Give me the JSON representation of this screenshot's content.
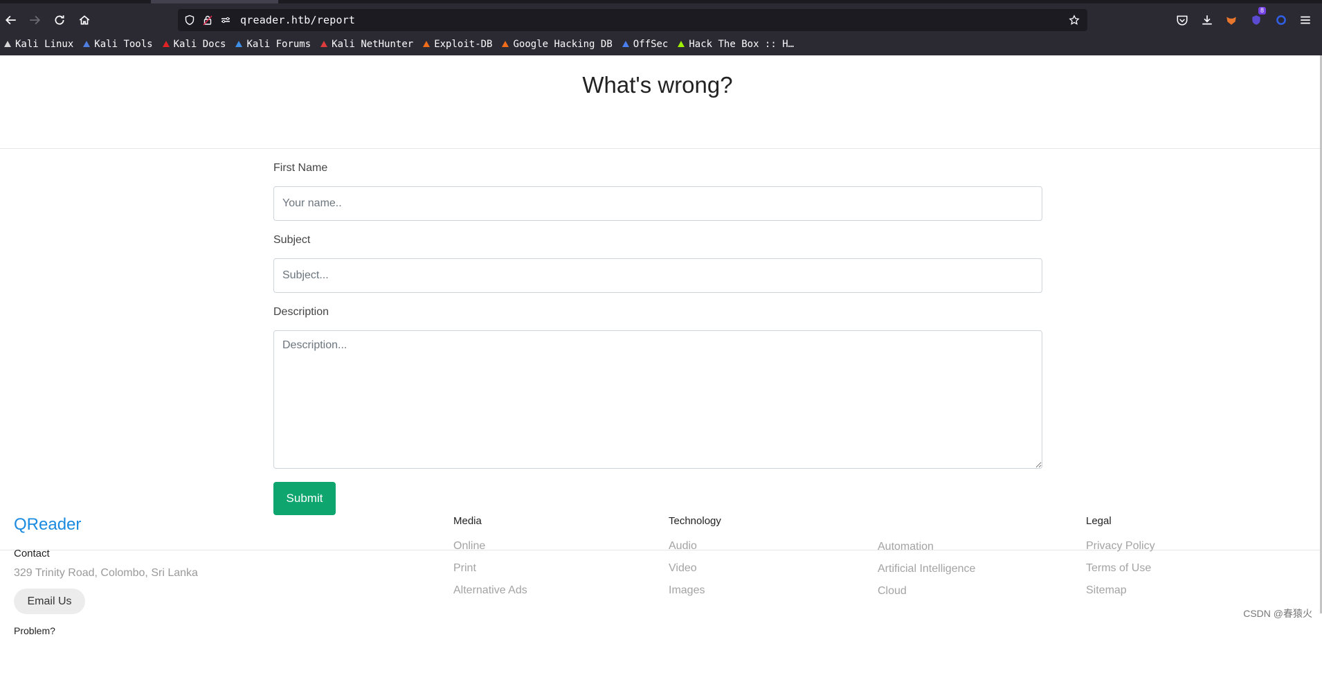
{
  "browser": {
    "url": "qreader.htb/report",
    "extension_badge": "8",
    "bookmarks": [
      {
        "label": "Kali Linux",
        "icon": "kali-dragon-icon",
        "color": "#d7d7d7"
      },
      {
        "label": "Kali Tools",
        "icon": "kali-tools-icon",
        "color": "#4e7fe0"
      },
      {
        "label": "Kali Docs",
        "icon": "kali-docs-icon",
        "color": "#e02424"
      },
      {
        "label": "Kali Forums",
        "icon": "kali-forums-icon",
        "color": "#3f8fe6"
      },
      {
        "label": "Kali NetHunter",
        "icon": "nethunter-icon",
        "color": "#e03c3c"
      },
      {
        "label": "Exploit-DB",
        "icon": "exploit-db-icon",
        "color": "#ef6c1a"
      },
      {
        "label": "Google Hacking DB",
        "icon": "ghdb-icon",
        "color": "#ef6c1a"
      },
      {
        "label": "OffSec",
        "icon": "offsec-icon",
        "color": "#4a7ff0"
      },
      {
        "label": "Hack The Box :: H…",
        "icon": "htb-cube-icon",
        "color": "#9fef00"
      }
    ]
  },
  "page": {
    "title": "What's wrong?",
    "form": {
      "first_name_label": "First Name",
      "first_name_placeholder": "Your name..",
      "subject_label": "Subject",
      "subject_placeholder": "Subject...",
      "description_label": "Description",
      "description_placeholder": "Description...",
      "submit_label": "Submit"
    },
    "accent_color": "#0ea66e"
  },
  "footer": {
    "brand": "QReader",
    "contact_heading": "Contact",
    "address": "329 Trinity Road, Colombo, Sri Lanka",
    "email_button": "Email Us",
    "problem_text": "Problem?",
    "columns": [
      {
        "heading": "Media",
        "links": [
          "Online",
          "Print",
          "Alternative Ads"
        ]
      },
      {
        "heading": "Technology",
        "links": [
          "Audio",
          "Video",
          "Images"
        ]
      },
      {
        "heading": "",
        "links": [
          "Automation",
          "Artificial Intelligence",
          "Cloud"
        ]
      },
      {
        "heading": "Legal",
        "links": [
          "Privacy Policy",
          "Terms of Use",
          "Sitemap"
        ]
      }
    ]
  },
  "watermark": "CSDN @春猿火"
}
